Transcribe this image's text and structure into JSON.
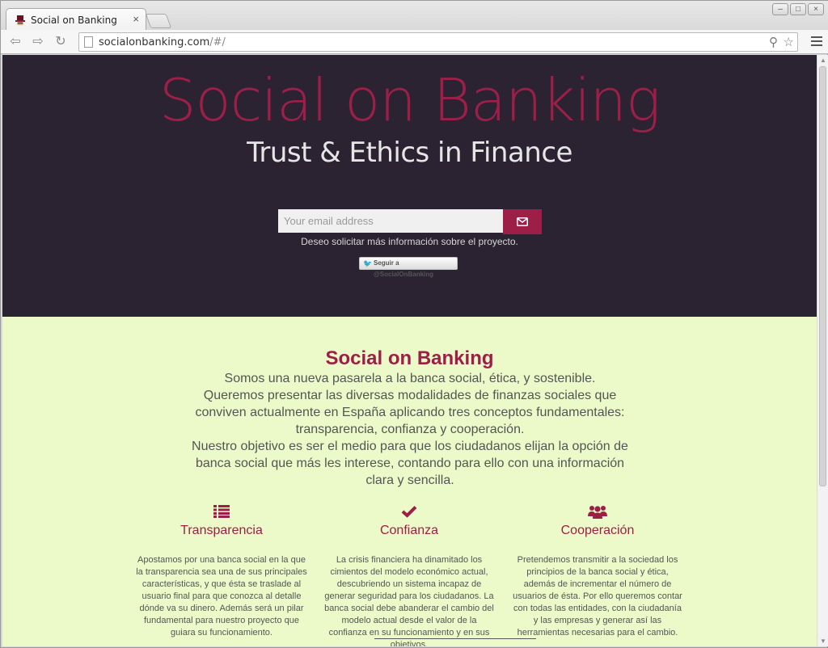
{
  "browser": {
    "tab_title": "Social on Banking",
    "url_host": "socialonbanking.com",
    "url_path": "/#/"
  },
  "hero": {
    "title": "Social on Banking",
    "subtitle": "Trust & Ethics in Finance",
    "email_placeholder": "Your email address",
    "note": "Deseo solicitar más información sobre el proyecto.",
    "twitter_button": "Seguir a @SocialOnBanking"
  },
  "about": {
    "title": "Social on Banking",
    "lines": [
      "Somos una nueva pasarela a la banca social, ética, y sostenible.",
      "Queremos presentar las diversas modalidades de finanzas sociales que conviven actualmente en España aplicando tres conceptos fundamentales: transparencia, confianza y cooperación.",
      "Nuestro objetivo es ser el medio para que los ciudadanos elijan la opción de banca social que más les interese, contando para ello con una información clara y sencilla."
    ]
  },
  "features": [
    {
      "icon": "list-icon",
      "title": "Transparencia",
      "text": "Apostamos por una banca social en la que la transparencia sea una de sus principales características, y que ésta se traslade al usuario final para que conozca al detalle dónde va su dinero. Además será un pilar fundamental para nuestro proyecto que guiara su funcionamiento."
    },
    {
      "icon": "check-icon",
      "title": "Confianza",
      "text": "La crisis financiera ha dinamitado los cimientos del modelo económico actual, descubriendo un sistema incapaz de generar seguridad para los ciudadanos. La banca social debe abanderar el cambio del modelo actual desde el valor de la confianza en su funcionamiento y en sus objetivos."
    },
    {
      "icon": "users-icon",
      "title": "Cooperación",
      "text": "Pretendemos transmitir a la sociedad los principios de la banca social y ética, además de incrementar el número de usuarios de ésta. Por ello queremos contar con todas las entidades, con la ciudadanía y las empresas y generar así las herramientas necesarias para el cambio."
    }
  ],
  "colors": {
    "accent": "#9d1f48",
    "hero_bg": "#2b2332",
    "about_bg": "#ebfac8"
  }
}
